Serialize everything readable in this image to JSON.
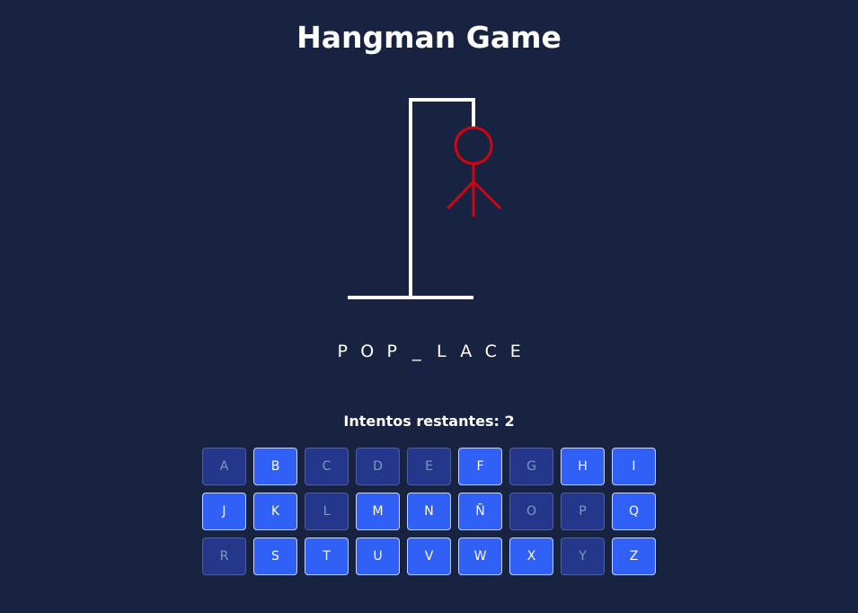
{
  "title": "Hangman Game",
  "word": [
    "P",
    "O",
    "P",
    "_",
    "L",
    "A",
    "C",
    "E"
  ],
  "attempts_label": "Intentos restantes: 2",
  "colors": {
    "background": "#172341",
    "key_active": "#3060f5",
    "key_used": "#24378a",
    "hangman": "#d2040f",
    "gallows": "#ffffff"
  },
  "keyboard": [
    {
      "letter": "A",
      "used": true
    },
    {
      "letter": "B",
      "used": false
    },
    {
      "letter": "C",
      "used": true
    },
    {
      "letter": "D",
      "used": true
    },
    {
      "letter": "E",
      "used": true
    },
    {
      "letter": "F",
      "used": false
    },
    {
      "letter": "G",
      "used": true
    },
    {
      "letter": "H",
      "used": false
    },
    {
      "letter": "I",
      "used": false
    },
    {
      "letter": "J",
      "used": false
    },
    {
      "letter": "K",
      "used": false
    },
    {
      "letter": "L",
      "used": true
    },
    {
      "letter": "M",
      "used": false
    },
    {
      "letter": "N",
      "used": false
    },
    {
      "letter": "Ñ",
      "used": false
    },
    {
      "letter": "O",
      "used": true
    },
    {
      "letter": "P",
      "used": true
    },
    {
      "letter": "Q",
      "used": false
    },
    {
      "letter": "R",
      "used": true
    },
    {
      "letter": "S",
      "used": false
    },
    {
      "letter": "T",
      "used": false
    },
    {
      "letter": "U",
      "used": false
    },
    {
      "letter": "V",
      "used": false
    },
    {
      "letter": "W",
      "used": false
    },
    {
      "letter": "X",
      "used": false
    },
    {
      "letter": "Y",
      "used": true
    },
    {
      "letter": "Z",
      "used": false
    }
  ]
}
